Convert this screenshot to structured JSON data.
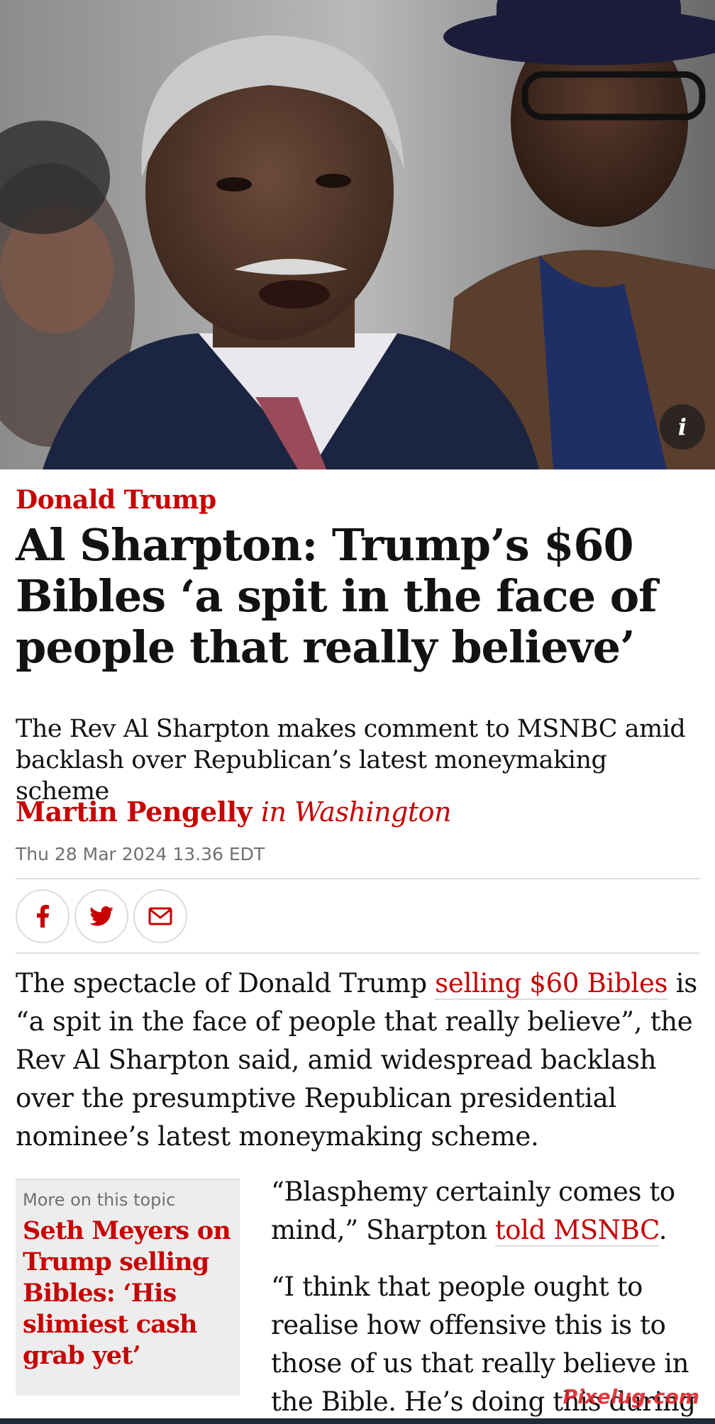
{
  "hero": {
    "info_label": "i"
  },
  "article": {
    "kicker": "Donald Trump",
    "headline": "Al Sharpton: Trump’s $60 Bibles ‘a spit in the face of people that really believe’",
    "standfirst": "The Rev Al Sharpton makes comment to MSNBC amid backlash over Republican’s latest moneymaking scheme",
    "byline": {
      "author": "Martin Pengelly",
      "location": "in Washington"
    },
    "dateline": "Thu 28 Mar 2024 13.36 EDT",
    "share": [
      {
        "icon": "facebook-icon"
      },
      {
        "icon": "twitter-icon"
      },
      {
        "icon": "email-icon"
      }
    ],
    "para1": {
      "before": "The spectacle of Donald Trump ",
      "link": "selling $60 Bibles",
      "after": " is “a spit in the face of people that really believe”, the Rev Al Sharpton said, amid widespread backlash over the presumptive Republican presidential nominee’s latest moneymaking scheme."
    },
    "related": {
      "label": "More on this topic",
      "title": "Seth Meyers on Trump selling Bibles: ‘His slimiest cash grab yet’"
    },
    "para2": {
      "before": "“Blasphemy certainly comes to mind,” Sharpton ",
      "link": "told MSNBC",
      "after": "."
    },
    "para3": "“I think that people ought to realise how offensive this is to those of us that really believe in the Bible. He’s doing this during"
  },
  "watermark": "Pixelug.com",
  "colors": {
    "accent": "#c70000",
    "text": "#121212",
    "muted": "#707070",
    "divider": "#dcdcdc"
  }
}
